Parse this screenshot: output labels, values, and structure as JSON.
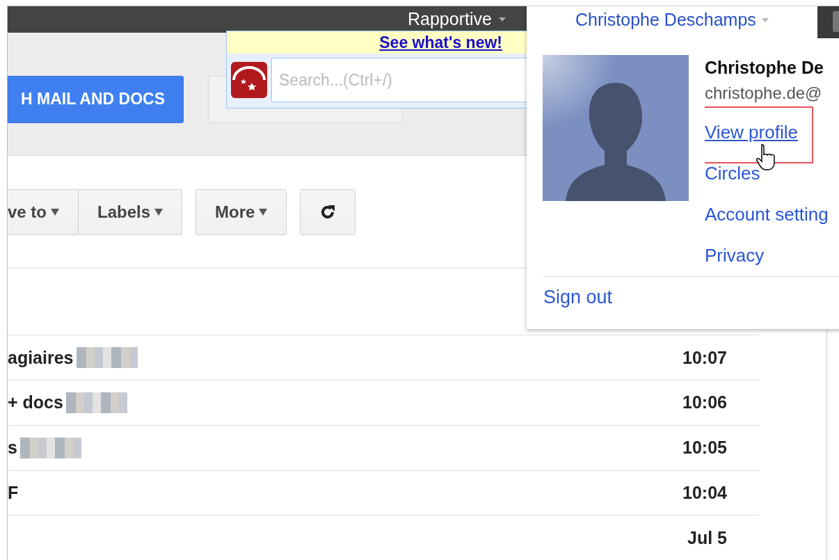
{
  "top_bar": {
    "menu_label": "Rapportive"
  },
  "rapportive": {
    "link": "See what's new!",
    "search": {
      "placeholder": "Search...(Ctrl+/)"
    }
  },
  "header": {
    "search_button": "H MAIL AND DOCS"
  },
  "toolbar": {
    "groups": [
      {
        "buttons": [
          {
            "kind": "dropdown",
            "label": "ve to"
          },
          {
            "kind": "dropdown",
            "label": "Labels"
          }
        ]
      },
      {
        "buttons": [
          {
            "kind": "dropdown",
            "label": "More"
          }
        ]
      },
      {
        "buttons": [
          {
            "kind": "refresh"
          }
        ]
      }
    ]
  },
  "messages": [
    {
      "subject": "agiaires",
      "redacted": true,
      "time": "10:07"
    },
    {
      "subject": "+ docs",
      "redacted": true,
      "time": "10:06"
    },
    {
      "subject": "s",
      "redacted": true,
      "time": "10:05"
    },
    {
      "subject": "F",
      "redacted": false,
      "time": "10:04"
    },
    {
      "redacted": false,
      "time": "Jul 5"
    }
  ],
  "account": {
    "name": "Christophe Deschamps",
    "full_name": "Christophe De",
    "email": "christophe.de@",
    "links": [
      {
        "label": "View profile",
        "highlighted": true
      },
      {
        "label": "Circles",
        "highlighted": false
      },
      {
        "label": "Account setting",
        "highlighted": false
      },
      {
        "label": "Privacy",
        "highlighted": false
      }
    ],
    "sign_out": "Sign out"
  }
}
